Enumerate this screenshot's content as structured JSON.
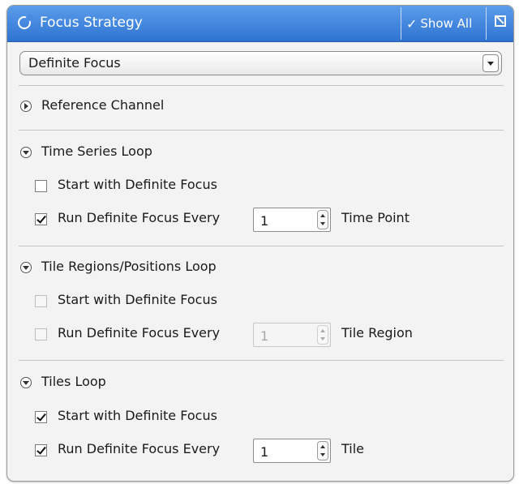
{
  "header": {
    "title": "Focus Strategy",
    "show_all_label": "Show All",
    "show_all_icon": "checkmark-icon",
    "edit_icon": "edit-icon",
    "accent_color": "#3a7fdc"
  },
  "strategy_select": {
    "value": "Definite Focus"
  },
  "sections": {
    "reference": {
      "title": "Reference Channel",
      "state": "collapsed"
    },
    "time_series": {
      "title": "Time Series Loop",
      "state": "expanded",
      "start_label": "Start with Definite Focus",
      "start_checked": false,
      "run_label": "Run Definite Focus Every",
      "run_checked": true,
      "run_value": "1",
      "run_unit": "Time Point"
    },
    "tile_regions": {
      "title": "Tile Regions/Positions Loop",
      "state": "expanded",
      "start_label": "Start with Definite Focus",
      "start_checked": false,
      "run_label": "Run Definite Focus Every",
      "run_checked": false,
      "run_value": "1",
      "run_unit": "Tile Region"
    },
    "tiles": {
      "title": "Tiles Loop",
      "state": "expanded",
      "start_label": "Start with Definite Focus",
      "start_checked": true,
      "run_label": "Run Definite Focus Every",
      "run_checked": true,
      "run_value": "1",
      "run_unit": "Tile"
    }
  }
}
